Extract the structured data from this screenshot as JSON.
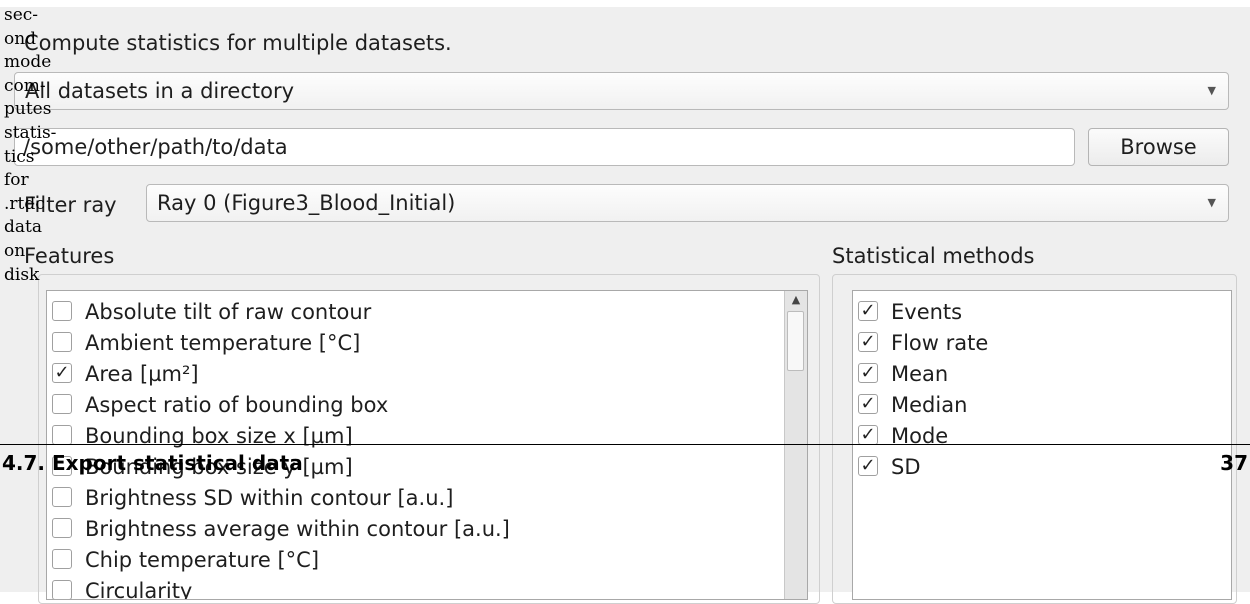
{
  "margin_note": [
    "sec-",
    "ond",
    "mode",
    "com-",
    "putes",
    "statis-",
    "tics",
    "for",
    ".rtdc",
    "data",
    "on",
    "disk"
  ],
  "dialog": {
    "heading": "Compute statistics for multiple datasets.",
    "mode_select": {
      "value": "All datasets in a directory"
    },
    "path_input": {
      "value": "/some/other/path/to/data"
    },
    "browse_label": "Browse",
    "filter_ray": {
      "label": "Filter ray",
      "value": "Ray 0 (Figure3_Blood_Initial)"
    }
  },
  "features": {
    "title": "Features",
    "items": [
      {
        "label": "Absolute tilt of raw contour",
        "mark": ""
      },
      {
        "label": "Ambient temperature [°C]",
        "mark": ""
      },
      {
        "label": "Area [µm²]",
        "mark": "✓"
      },
      {
        "label": "Aspect ratio of bounding box",
        "mark": ""
      },
      {
        "label": "Bounding box size x [µm]",
        "mark": ""
      },
      {
        "label": "Bounding box size y [µm]",
        "mark": ""
      },
      {
        "label": "Brightness SD within contour [a.u.]",
        "mark": ""
      },
      {
        "label": "Brightness average within contour [a.u.]",
        "mark": ""
      },
      {
        "label": "Chip temperature [°C]",
        "mark": ""
      },
      {
        "label": "Circularity",
        "mark": ""
      }
    ]
  },
  "methods": {
    "title": "Statistical methods",
    "items": [
      {
        "label": "Events",
        "mark": "✓"
      },
      {
        "label": "Flow rate",
        "mark": "✓"
      },
      {
        "label": "Mean",
        "mark": "✓"
      },
      {
        "label": "Median",
        "mark": "✓"
      },
      {
        "label": "Mode",
        "mark": "✓"
      },
      {
        "label": "SD",
        "mark": "✓"
      }
    ]
  },
  "footer": {
    "section": "4.7. Export statistical data",
    "page": "37"
  },
  "icons": {
    "dropdown": "chevron-down-icon",
    "scroll_up": "arrow-up-icon",
    "check": "checkmark-icon"
  }
}
